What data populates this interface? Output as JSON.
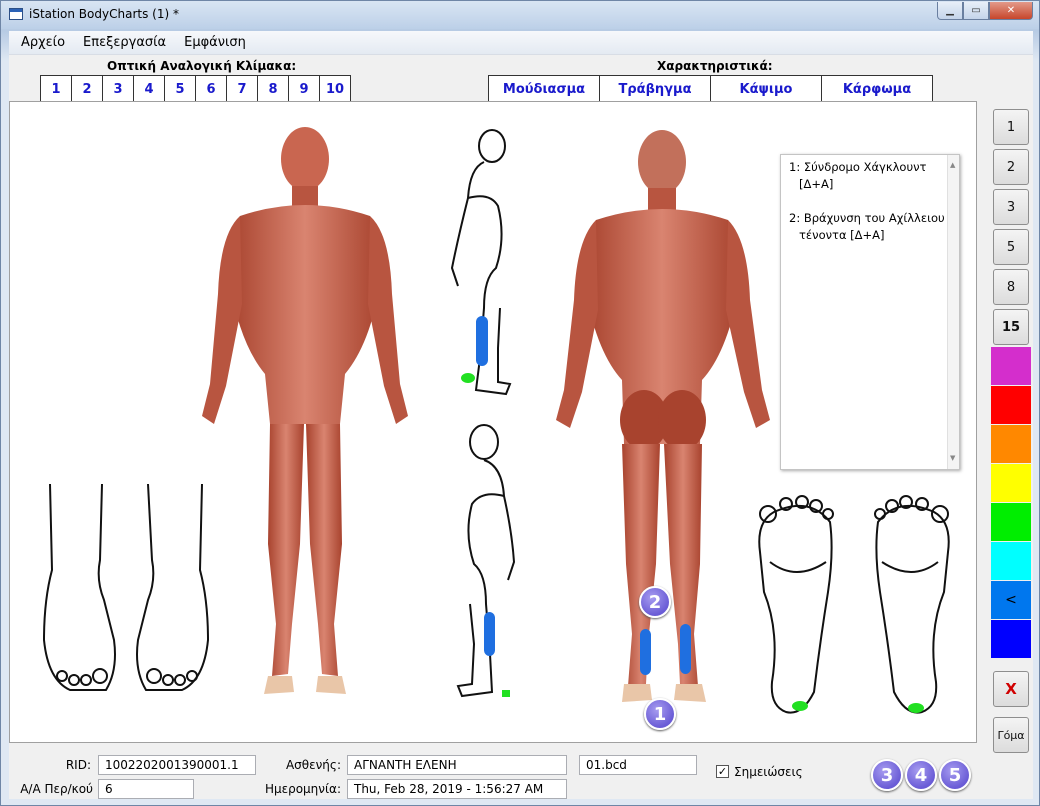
{
  "window": {
    "title": "iStation BodyCharts (1) *"
  },
  "menu": [
    "Αρχείο",
    "Επεξεργασία",
    "Εμφάνιση"
  ],
  "scale": {
    "title": "Οπτική Αναλογική Κλίμακα:",
    "values": [
      "1",
      "2",
      "3",
      "4",
      "5",
      "6",
      "7",
      "8",
      "9",
      "10"
    ],
    "marks": [
      {
        "value": "5",
        "color": "#1f6fe0"
      },
      {
        "value": "7",
        "color": "#22e022"
      }
    ]
  },
  "characteristics": {
    "title": "Χαρακτηριστικά:",
    "items": [
      "Μούδιασμα",
      "Τράβηγμα",
      "Κάψιμο",
      "Κάρφωμα"
    ],
    "marks": [
      {
        "item": "Τράβηγμα",
        "color": "#1f6fe0"
      },
      {
        "item": "Κάψιμο",
        "color": "#22e022"
      }
    ]
  },
  "notes": [
    {
      "line1": "1: Σύνδρομο Χάγκλουντ",
      "line2": "[Δ+Α]"
    },
    {
      "line1": "2: Βράχυνση του Αχίλλειου",
      "line2": "τένοντα [Δ+Α]"
    }
  ],
  "brush_sizes": [
    "1",
    "2",
    "3",
    "5",
    "8",
    "15"
  ],
  "selected_brush": "15",
  "palette": [
    {
      "color": "#d42ecc",
      "label": ""
    },
    {
      "color": "#ff0000",
      "label": ""
    },
    {
      "color": "#ff8800",
      "label": ""
    },
    {
      "color": "#ffff00",
      "label": ""
    },
    {
      "color": "#00ee00",
      "label": ""
    },
    {
      "color": "#00ffff",
      "label": ""
    },
    {
      "color": "#0077ee",
      "label": "<"
    },
    {
      "color": "#0000ff",
      "label": ""
    }
  ],
  "clear_label": "X",
  "eraser_label": "Γόμα",
  "markers": [
    "1",
    "2"
  ],
  "bottom_markers": [
    "3",
    "4",
    "5"
  ],
  "status": {
    "rid_label": "RID:",
    "rid_value": "1002202001390001.1",
    "patient_label": "Ασθενής:",
    "patient_value": "ΑΓΝΑΝΤΗ ΕΛΕΝΗ",
    "file_value": "01.bcd",
    "visit_label": "Α/Α Περ/κού",
    "visit_value": "6",
    "date_label": "Ημερομηνία:",
    "date_value": "Thu, Feb 28, 2019 - 1:56:27 AM",
    "notes_checkbox_label": "Σημειώσεις",
    "notes_checked": true
  }
}
